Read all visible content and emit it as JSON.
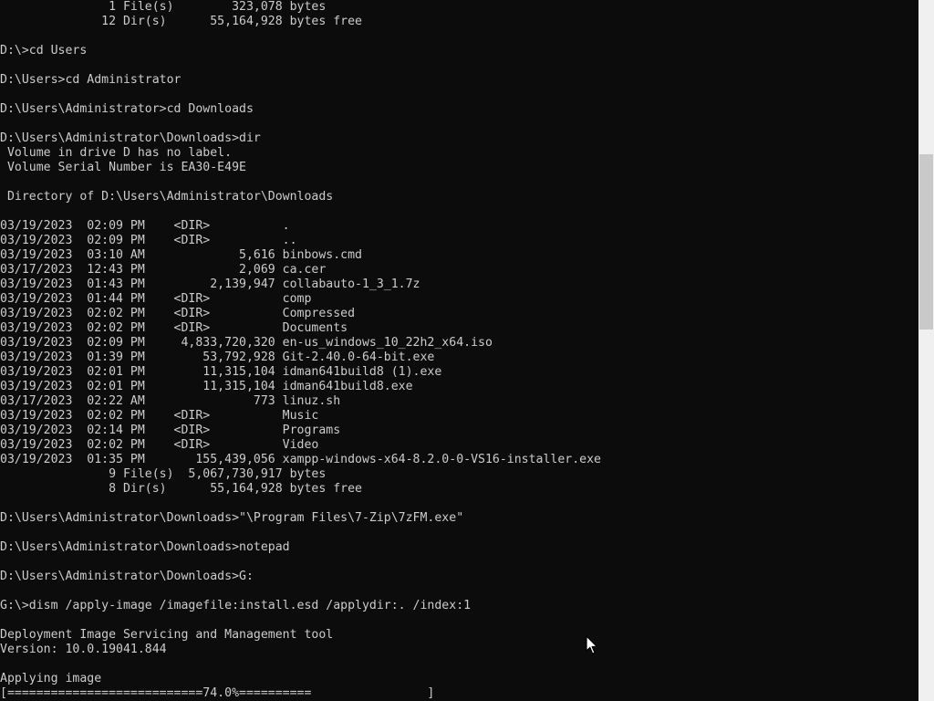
{
  "scrollbar": {
    "thumb_position": 0.22,
    "thumb_fraction": 0.25
  },
  "icons": {
    "cursor": "mouse-pointer-icon"
  },
  "lines": [
    {
      "text": "               1 File(s)        323,078 bytes",
      "type": "output"
    },
    {
      "text": "              12 Dir(s)      55,164,928 bytes free",
      "type": "output"
    },
    {
      "text": "",
      "type": "blank"
    },
    {
      "text": "D:\\>cd Users",
      "type": "command"
    },
    {
      "text": "",
      "type": "blank"
    },
    {
      "text": "D:\\Users>cd Administrator",
      "type": "command"
    },
    {
      "text": "",
      "type": "blank"
    },
    {
      "text": "D:\\Users\\Administrator>cd Downloads",
      "type": "command"
    },
    {
      "text": "",
      "type": "blank"
    },
    {
      "text": "D:\\Users\\Administrator\\Downloads>dir",
      "type": "command"
    },
    {
      "text": " Volume in drive D has no label.",
      "type": "output"
    },
    {
      "text": " Volume Serial Number is EA30-E49E",
      "type": "output"
    },
    {
      "text": "",
      "type": "blank"
    },
    {
      "text": " Directory of D:\\Users\\Administrator\\Downloads",
      "type": "output"
    },
    {
      "text": "",
      "type": "blank"
    },
    {
      "text": "03/19/2023  02:09 PM    <DIR>          .",
      "type": "dir-entry"
    },
    {
      "text": "03/19/2023  02:09 PM    <DIR>          ..",
      "type": "dir-entry"
    },
    {
      "text": "03/19/2023  03:10 AM             5,616 binbows.cmd",
      "type": "dir-entry"
    },
    {
      "text": "03/17/2023  12:43 PM             2,069 ca.cer",
      "type": "dir-entry"
    },
    {
      "text": "03/19/2023  01:43 PM         2,139,947 collabauto-1_3_1.7z",
      "type": "dir-entry"
    },
    {
      "text": "03/19/2023  01:44 PM    <DIR>          comp",
      "type": "dir-entry"
    },
    {
      "text": "03/19/2023  02:02 PM    <DIR>          Compressed",
      "type": "dir-entry"
    },
    {
      "text": "03/19/2023  02:02 PM    <DIR>          Documents",
      "type": "dir-entry"
    },
    {
      "text": "03/19/2023  02:09 PM     4,833,720,320 en-us_windows_10_22h2_x64.iso",
      "type": "dir-entry"
    },
    {
      "text": "03/19/2023  01:39 PM        53,792,928 Git-2.40.0-64-bit.exe",
      "type": "dir-entry"
    },
    {
      "text": "03/19/2023  02:01 PM        11,315,104 idman641build8 (1).exe",
      "type": "dir-entry"
    },
    {
      "text": "03/19/2023  02:01 PM        11,315,104 idman641build8.exe",
      "type": "dir-entry"
    },
    {
      "text": "03/17/2023  02:22 AM               773 linuz.sh",
      "type": "dir-entry"
    },
    {
      "text": "03/19/2023  02:02 PM    <DIR>          Music",
      "type": "dir-entry"
    },
    {
      "text": "03/19/2023  02:14 PM    <DIR>          Programs",
      "type": "dir-entry"
    },
    {
      "text": "03/19/2023  02:02 PM    <DIR>          Video",
      "type": "dir-entry"
    },
    {
      "text": "03/19/2023  01:35 PM       155,439,056 xampp-windows-x64-8.2.0-0-VS16-installer.exe",
      "type": "dir-entry"
    },
    {
      "text": "               9 File(s)  5,067,730,917 bytes",
      "type": "output"
    },
    {
      "text": "               8 Dir(s)      55,164,928 bytes free",
      "type": "output"
    },
    {
      "text": "",
      "type": "blank"
    },
    {
      "text": "D:\\Users\\Administrator\\Downloads>\"\\Program Files\\7-Zip\\7zFM.exe\"",
      "type": "command"
    },
    {
      "text": "",
      "type": "blank"
    },
    {
      "text": "D:\\Users\\Administrator\\Downloads>notepad",
      "type": "command"
    },
    {
      "text": "",
      "type": "blank"
    },
    {
      "text": "D:\\Users\\Administrator\\Downloads>G:",
      "type": "command"
    },
    {
      "text": "",
      "type": "blank"
    },
    {
      "text": "G:\\>dism /apply-image /imagefile:install.esd /applydir:. /index:1",
      "type": "command"
    },
    {
      "text": "",
      "type": "blank"
    },
    {
      "text": "Deployment Image Servicing and Management tool",
      "type": "output"
    },
    {
      "text": "Version: 10.0.19041.844",
      "type": "output"
    },
    {
      "text": "",
      "type": "blank"
    },
    {
      "text": "Applying image",
      "type": "output"
    },
    {
      "text": "[===========================74.0%==========                ]",
      "type": "progress"
    }
  ],
  "progress": {
    "label": "Applying image",
    "percent": 74.0,
    "display": "74.0%"
  }
}
